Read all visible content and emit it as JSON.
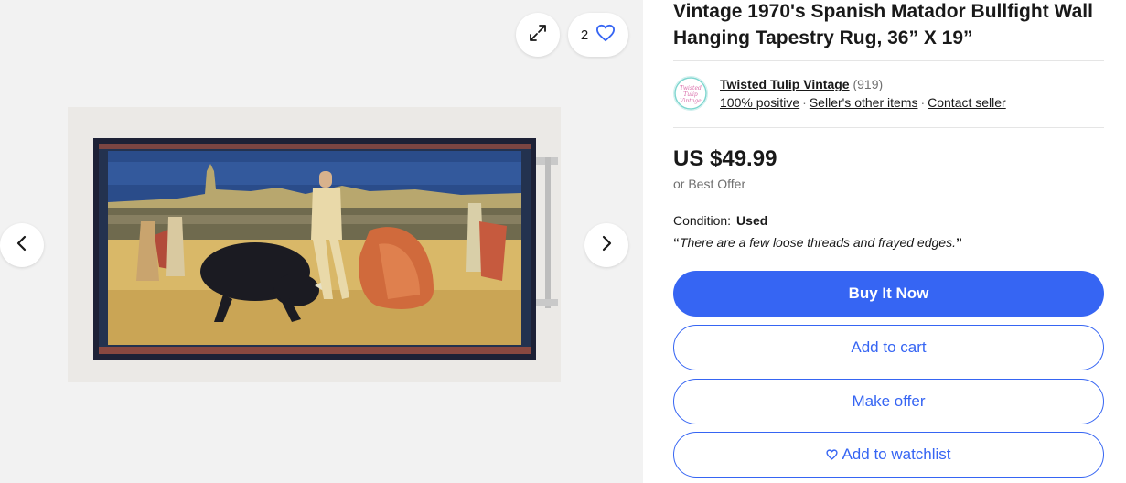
{
  "gallery": {
    "watch_count": "2",
    "icons": {
      "expand": "expand-arrows-icon",
      "watch": "heart-outline-icon",
      "prev": "chevron-left-icon",
      "next": "chevron-right-icon"
    }
  },
  "item": {
    "title": "Vintage 1970's Spanish Matador Bullfight Wall Hanging Tapestry Rug, 36” X 19”"
  },
  "seller": {
    "name": "Twisted Tulip Vintage",
    "feedback_count": "(919)",
    "positive": "100% positive",
    "other_items": "Seller's other items",
    "contact": "Contact seller",
    "logo_text": "Twisted Tulip Vintage"
  },
  "pricing": {
    "price": "US $49.99",
    "best_offer": "or Best Offer"
  },
  "condition": {
    "label": "Condition:",
    "value": "Used",
    "quote_open": "“",
    "note": "There are a few loose threads and frayed edges.",
    "quote_close": "”"
  },
  "actions": {
    "buy_now": "Buy It Now",
    "add_to_cart": "Add to cart",
    "make_offer": "Make offer",
    "add_to_watchlist": "Add to watchlist"
  },
  "colors": {
    "accent": "#3665f3",
    "text": "#191919",
    "muted": "#707070",
    "gallery_bg": "#f2f2f2"
  }
}
